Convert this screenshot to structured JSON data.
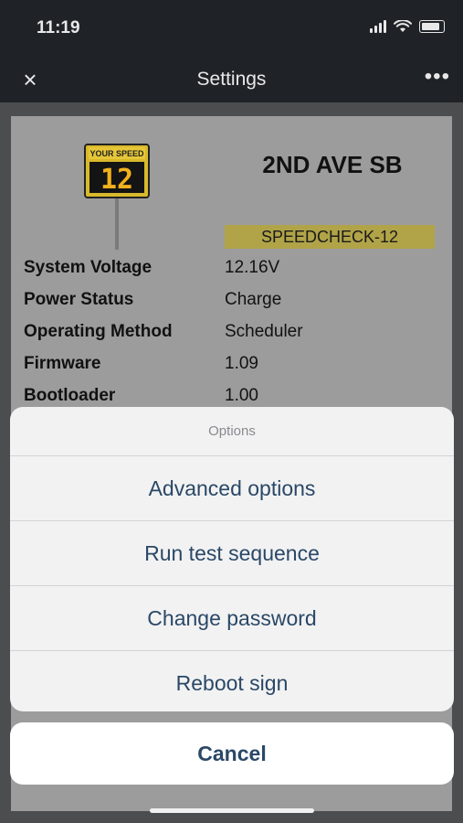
{
  "status_bar": {
    "time": "11:19"
  },
  "nav": {
    "close_icon": "×",
    "title": "Settings",
    "more_icon": "•••"
  },
  "sign": {
    "name": "2ND AVE SB",
    "id": "SPEEDCHECK-12",
    "display_label": "YOUR SPEED",
    "display_value": "12"
  },
  "info": [
    {
      "label": "System Voltage",
      "value": "12.16V"
    },
    {
      "label": "Power Status",
      "value": "Charge"
    },
    {
      "label": "Operating Method",
      "value": "Scheduler"
    },
    {
      "label": "Firmware",
      "value": "1.09"
    },
    {
      "label": "Bootloader",
      "value": "1.00"
    }
  ],
  "sheet": {
    "header": "Options",
    "options": [
      {
        "label": "Advanced options"
      },
      {
        "label": "Run test sequence"
      },
      {
        "label": "Change password"
      },
      {
        "label": "Reboot sign"
      }
    ],
    "cancel_label": "Cancel"
  },
  "colors": {
    "sheet_text": "#2a4866",
    "id_badge": "#b1a448",
    "sign_face": "#e2c232",
    "digits": "#f2b11c"
  }
}
